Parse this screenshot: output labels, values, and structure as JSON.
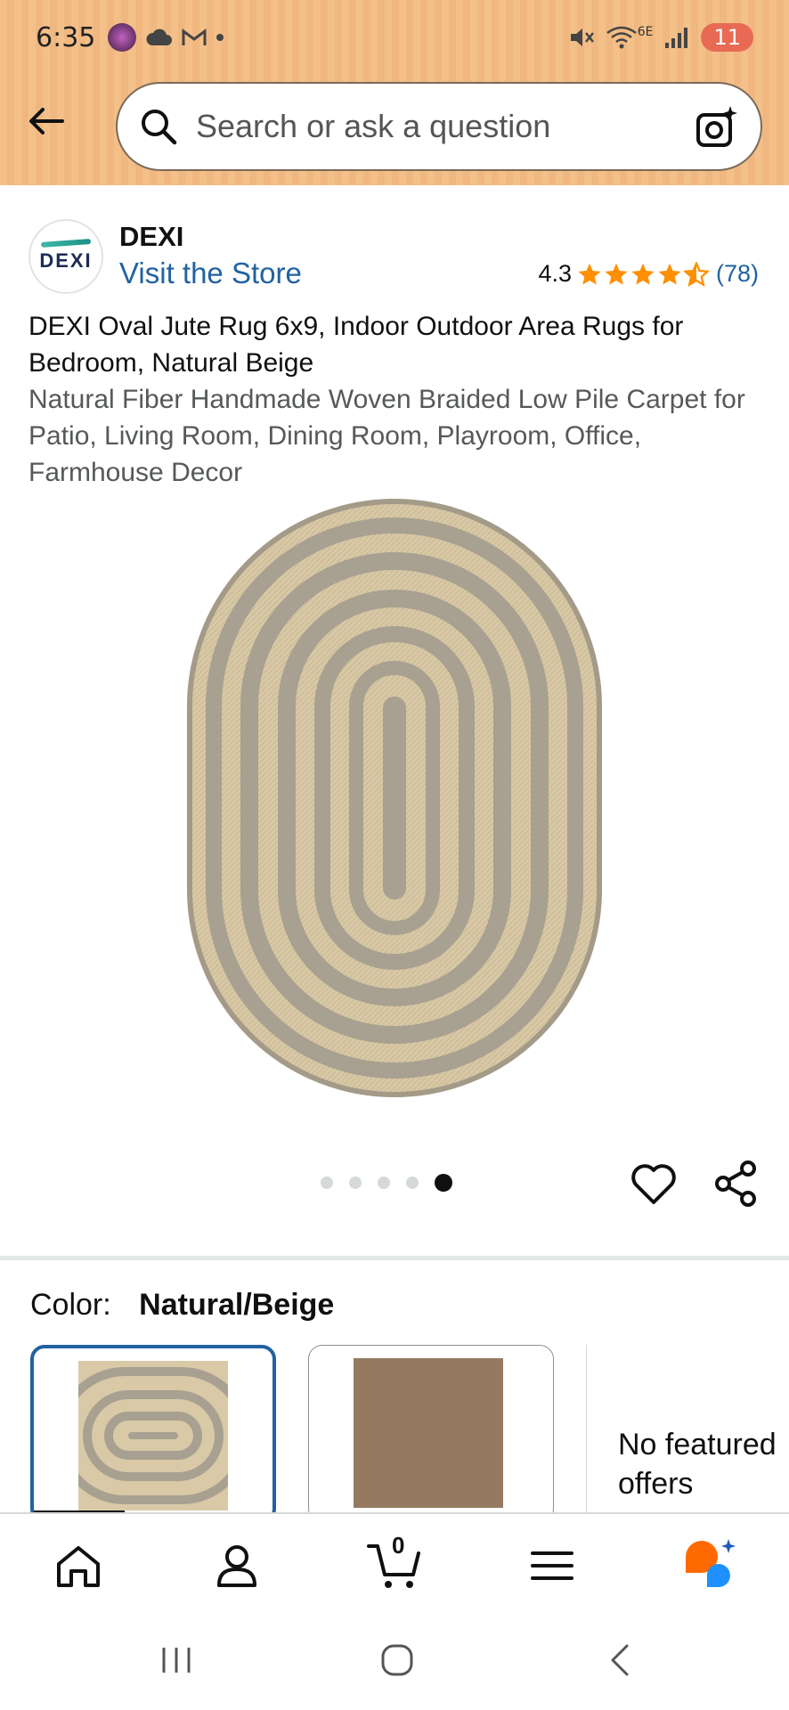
{
  "status_bar": {
    "time": "6:35",
    "battery": "11",
    "network": "6E"
  },
  "search": {
    "placeholder": "Search or ask a question"
  },
  "brand": {
    "logo_text": "DEXI",
    "name": "DEXI",
    "visit_store": "Visit the Store"
  },
  "rating": {
    "value": "4.3",
    "count": "(78)",
    "stars": 4.3
  },
  "product": {
    "title": "DEXI Oval Jute Rug 6x9, Indoor Outdoor Area Rugs for Bedroom, Natural Beige",
    "subtitle": "Natural Fiber Handmade Woven Braided Low Pile Carpet for Patio, Living Room, Dining Room, Playroom, Office, Farmhouse Decor"
  },
  "carousel": {
    "total": 5,
    "active": 5
  },
  "color": {
    "label": "Color:",
    "value": "Natural/Beige"
  },
  "offers": {
    "no_featured": "No featured offers"
  },
  "cart": {
    "count": "0"
  },
  "colors": {
    "link": "#2162a1",
    "star": "#ff8f00",
    "header": "#f3c089"
  }
}
